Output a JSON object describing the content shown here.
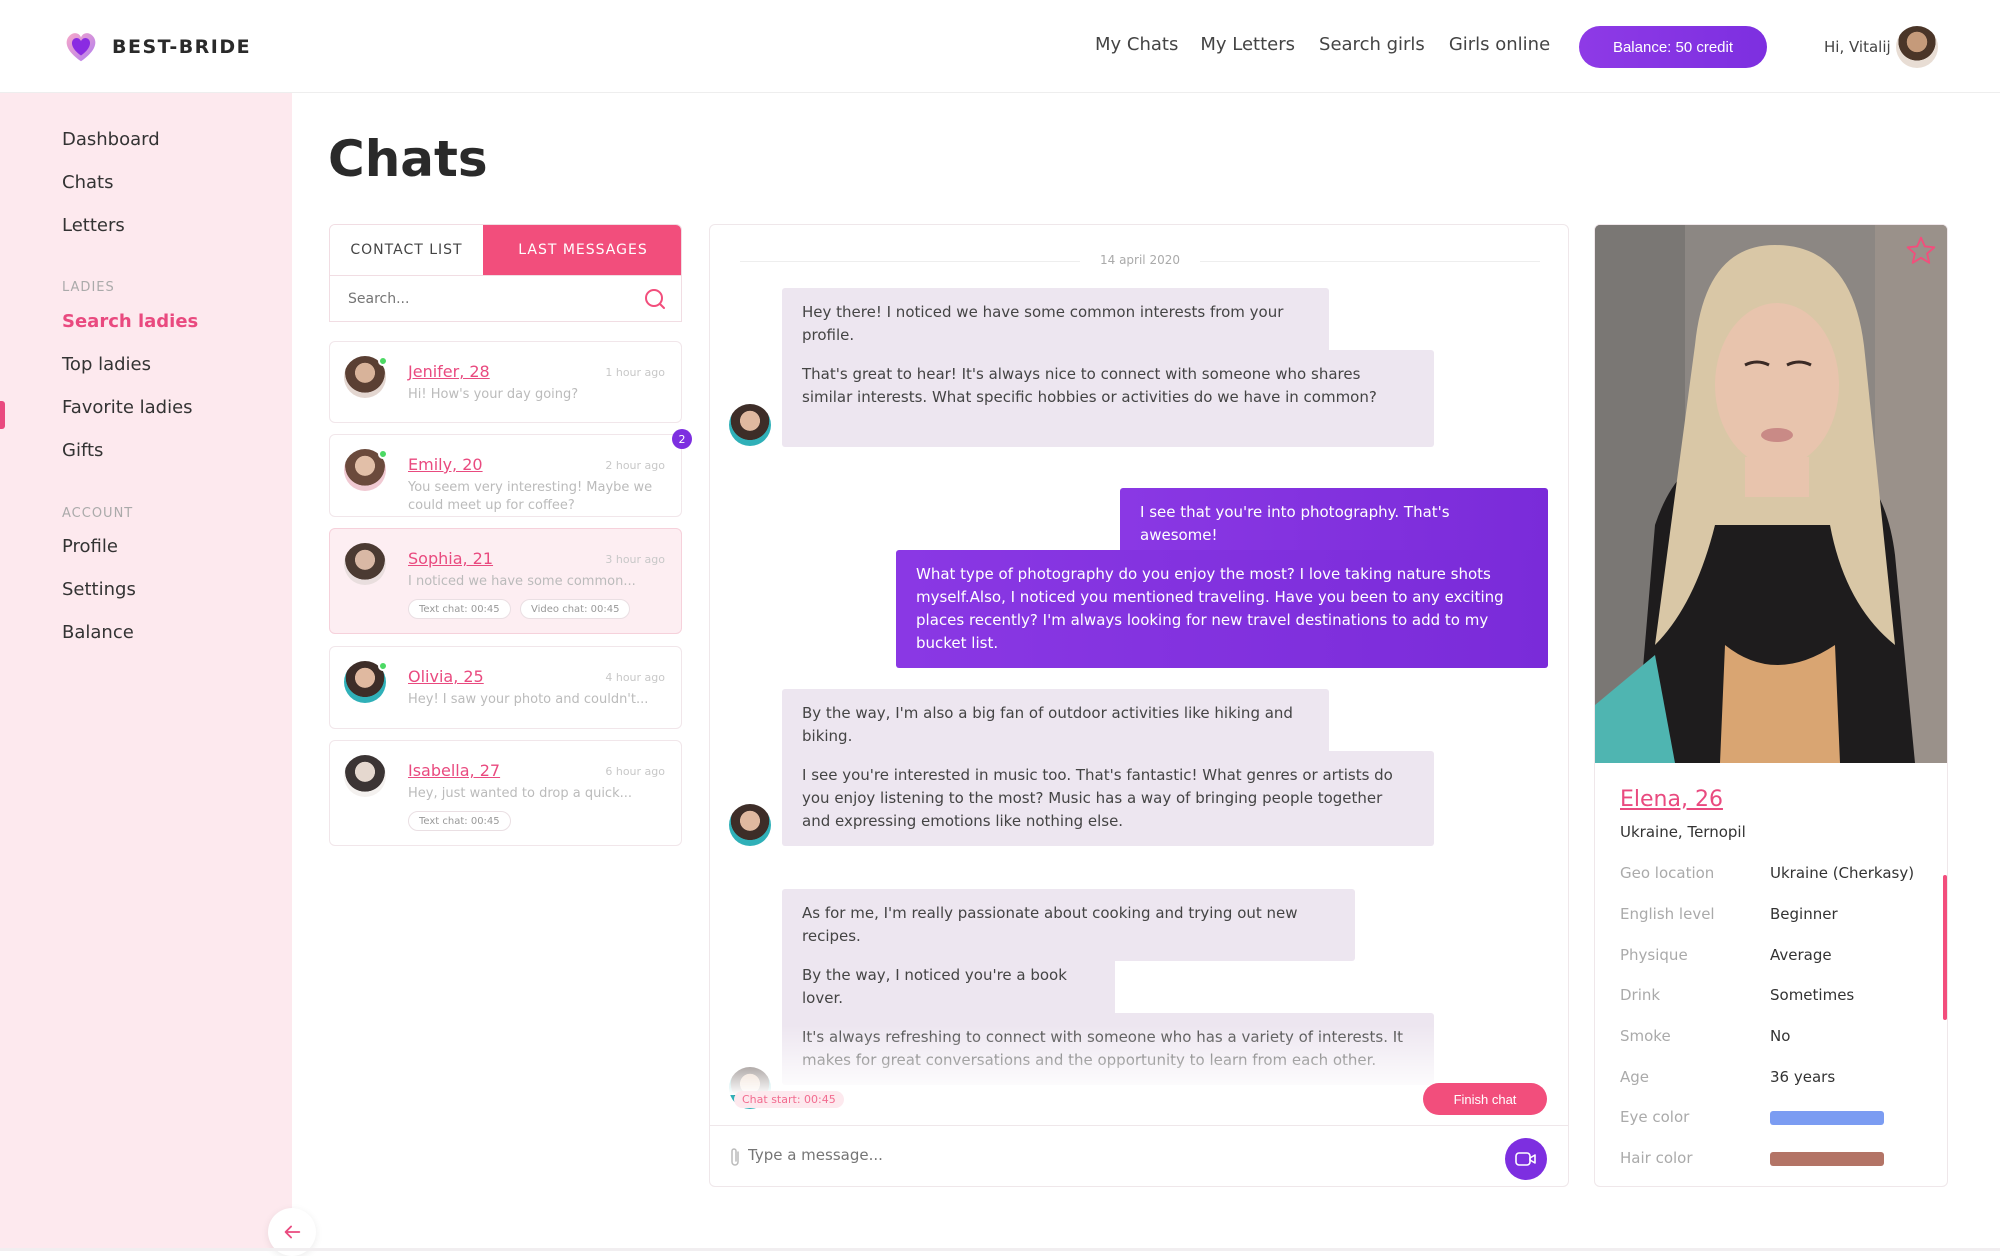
{
  "brand": {
    "name": "BEST-BRIDE"
  },
  "nav": {
    "items": [
      "My Chats",
      "My Letters",
      "Search girls",
      "Girls online"
    ]
  },
  "header": {
    "balance_label": "Balance: 50 credit",
    "greeting": "Hi, Vitalij"
  },
  "sidebar": {
    "main": [
      "Dashboard",
      "Chats",
      "Letters"
    ],
    "ladies_section": "LADIES",
    "ladies": [
      "Search ladies",
      "Top ladies",
      "Favorite ladies",
      "Gifts"
    ],
    "account_section": "ACCOUNT",
    "account": [
      "Profile",
      "Settings",
      "Balance"
    ],
    "active": "Search ladies"
  },
  "page": {
    "title": "Chats"
  },
  "contacts_panel": {
    "tabs": [
      "CONTACT LIST",
      "LAST MESSAGES"
    ],
    "active_tab": "LAST MESSAGES",
    "search_placeholder": "Search...",
    "contacts": [
      {
        "name": "Jenifer, 28",
        "time": "1 hour ago",
        "message": "Hi! How's your day going?",
        "online": true,
        "tags": []
      },
      {
        "name": "Emily, 20",
        "time": "2 hour ago",
        "message": "You seem very interesting! Maybe we could meet up for coffee?",
        "online": true,
        "unread": "2",
        "tags": []
      },
      {
        "name": "Sophia, 21",
        "time": "3 hour ago",
        "message": "I noticed we have some common...",
        "online": false,
        "tags": [
          "Text chat: 00:45",
          "Video chat: 00:45"
        ]
      },
      {
        "name": "Olivia, 25",
        "time": "4 hour ago",
        "message": "Hey! I saw your photo and couldn't...",
        "online": true,
        "tags": []
      },
      {
        "name": "Isabella, 27",
        "time": "6 hour ago",
        "message": "Hey, just wanted to drop a quick...",
        "online": false,
        "tags": [
          "Text chat: 00:45"
        ]
      }
    ]
  },
  "chat": {
    "date": "14 april 2020",
    "messages": [
      {
        "dir": "in",
        "text": "Hey there! I noticed we have some common interests from your profile."
      },
      {
        "dir": "in",
        "text": "That's great to hear! It's always nice to connect with someone who shares similar interests. What specific hobbies or activities do we have in common?"
      },
      {
        "dir": "out",
        "text": "I see that you're into photography. That's awesome!"
      },
      {
        "dir": "out",
        "text": "What type of photography do you enjoy the most? I love taking nature shots myself.Also, I noticed you mentioned traveling. Have you been to any exciting places recently? I'm always looking for new travel destinations to add to my bucket list."
      },
      {
        "dir": "in",
        "text": "By the way, I'm also a big fan of outdoor activities like hiking and biking."
      },
      {
        "dir": "in",
        "text": "I see you're interested in music too. That's fantastic! What genres or artists do you enjoy listening to the most? Music has a way of bringing people together and expressing emotions like nothing else."
      },
      {
        "dir": "in",
        "text": "As for me, I'm really passionate about cooking and trying out new recipes."
      },
      {
        "dir": "in",
        "text": "By the way, I noticed you're a book lover."
      },
      {
        "dir": "in",
        "text": "It's always refreshing to connect with someone who has a variety of interests. It makes for great conversations and the opportunity to learn from each other."
      }
    ],
    "chat_start": "Chat start: 00:45",
    "finish_label": "Finish chat",
    "input_placeholder": "Type a message..."
  },
  "profile": {
    "name": "Elena, 26",
    "location": "Ukraine, Ternopil",
    "fields": [
      {
        "key": "Geo location",
        "value": "Ukraine (Cherkasy)"
      },
      {
        "key": "English level",
        "value": "Beginner"
      },
      {
        "key": "Physique",
        "value": "Average"
      },
      {
        "key": "Drink",
        "value": "Sometimes"
      },
      {
        "key": "Smoke",
        "value": "No"
      },
      {
        "key": "Age",
        "value": "36 years"
      }
    ],
    "eye_color_label": "Eye color",
    "eye_color": "#7b9cf2",
    "hair_color_label": "Hair color",
    "hair_color": "#b37466"
  },
  "colors": {
    "accent_pink": "#f24e7c",
    "accent_purple": "#7d2fe0",
    "sidebar_bg": "#fde9ee"
  }
}
